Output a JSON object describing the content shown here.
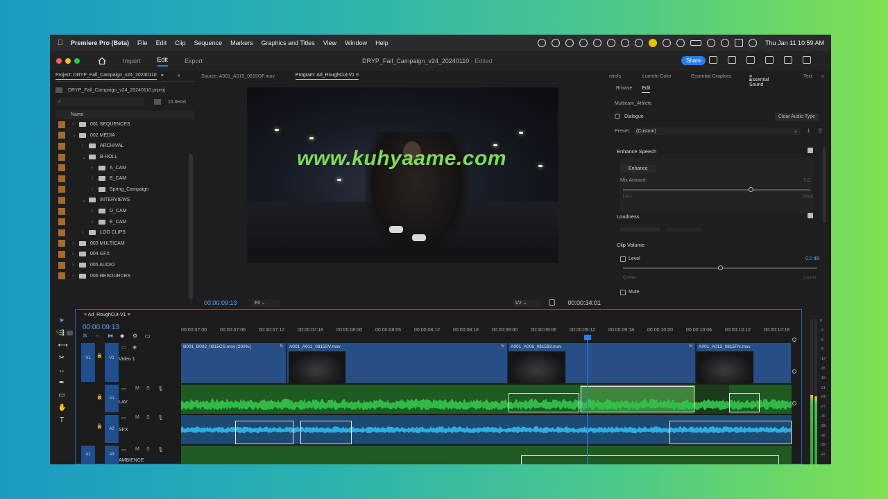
{
  "menubar": {
    "app": "Premiere Pro (Beta)",
    "items": [
      "File",
      "Edit",
      "Clip",
      "Sequence",
      "Markers",
      "Graphics and Titles",
      "View",
      "Window",
      "Help"
    ],
    "clock": "Thu Jan 11  10:59 AM"
  },
  "header": {
    "tabs": [
      "Import",
      "Edit",
      "Export"
    ],
    "title": "DRYP_Fall_Campaign_v24_20240110",
    "edited": " - Edited",
    "share": "Share"
  },
  "project": {
    "tab": "Project: DRYP_Fall_Campaign_v24_20240110",
    "file": "DRYP_Fall_Campaign_v24_20240110.prproj",
    "count": "15 items",
    "col_name": "Name",
    "tree": [
      {
        "label": "001 SEQUENCES",
        "depth": 0,
        "open": false
      },
      {
        "label": "002 MEDIA",
        "depth": 0,
        "open": true
      },
      {
        "label": "ARCHIVAL",
        "depth": 1,
        "open": false
      },
      {
        "label": "B-ROLL",
        "depth": 1,
        "open": true
      },
      {
        "label": "A_CAM",
        "depth": 2,
        "open": false
      },
      {
        "label": "B_CAM",
        "depth": 2,
        "open": false
      },
      {
        "label": "Spring_Campaign",
        "depth": 2,
        "open": false
      },
      {
        "label": "INTERVIEWS",
        "depth": 1,
        "open": true
      },
      {
        "label": "D_CAM",
        "depth": 2,
        "open": false
      },
      {
        "label": "E_CAM",
        "depth": 2,
        "open": false
      },
      {
        "label": "LOG CLIPS",
        "depth": 1,
        "open": false
      },
      {
        "label": "003 MULTICAM",
        "depth": 0,
        "open": false
      },
      {
        "label": "004 GFX",
        "depth": 0,
        "open": false
      },
      {
        "label": "005 AUDIO",
        "depth": 0,
        "open": false
      },
      {
        "label": "006 RESOURCES",
        "depth": 0,
        "open": false
      }
    ]
  },
  "monitor": {
    "source_tab": "Source: A001_A015_0815OF.mov",
    "program_tab": "Program: Ad_RoughCut-V1",
    "timecode": "00:00:09:13",
    "duration": "00:00:34:01",
    "fit": "Fit",
    "resolution": "1/2",
    "watermark": "www.kuhyaame.com"
  },
  "essential": {
    "tabs": [
      "ntrols",
      "Lumetri Color",
      "Essential Graphics",
      "Essential Sound",
      "Text"
    ],
    "sub_browse": "Browse",
    "sub_edit": "Edit",
    "clip": "Multicam_Athlete",
    "dialogue": "Dialogue",
    "clear": "Clear Audio Type",
    "preset_label": "Preset:",
    "preset_value": "(Custom)",
    "enhance_speech": "Enhance Speech",
    "enhance_btn": "Enhance",
    "mix_amount": "Mix Amount:",
    "mix_value": "7.0",
    "mix_less": "Less",
    "mix_more": "More",
    "loudness": "Loudness",
    "clip_volume": "Clip Volume",
    "level": "Level",
    "level_value": "0.0 dB",
    "quieter": "Quieter",
    "louder": "Louder",
    "mute": "Mute"
  },
  "timeline": {
    "tab": "Ad_RoughCut-V1",
    "timecode": "00:00:09:13",
    "ruler": [
      "00:00:07:00",
      "00:00:07:06",
      "00:00:07:12",
      "00:00:07:18",
      "00:00:08:00",
      "00:00:08:06",
      "00:00:08:12",
      "00:00:08:18",
      "00:00:09:00",
      "00:00:09:06",
      "00:00:09:12",
      "00:00:09:18",
      "00:00:10:00",
      "00:00:10:06",
      "00:00:10:12",
      "00:00:10:18"
    ],
    "tracks": {
      "v1_name": "Video 1",
      "a1_name": "LAV",
      "a2_name": "SFX",
      "a3_name": "AMBIENCE"
    },
    "clips": [
      {
        "label": "B001_B002_0815CS.mov [200%]"
      },
      {
        "label": "A001_A011_0815SV.mov"
      },
      {
        "label": "A001_A006_081593.mov"
      },
      {
        "label": "A001_A013_0815FN.mov"
      }
    ],
    "meter_scale": [
      "0",
      "-3",
      "-6",
      "-9",
      "-12",
      "-15",
      "-18",
      "-21",
      "-24",
      "-27",
      "-30",
      "-33",
      "-36",
      "-39",
      "-42"
    ],
    "meter_level_left": 0.55,
    "meter_level_right": 0.52,
    "mix_position": 0.68,
    "level_position": 0.5
  }
}
